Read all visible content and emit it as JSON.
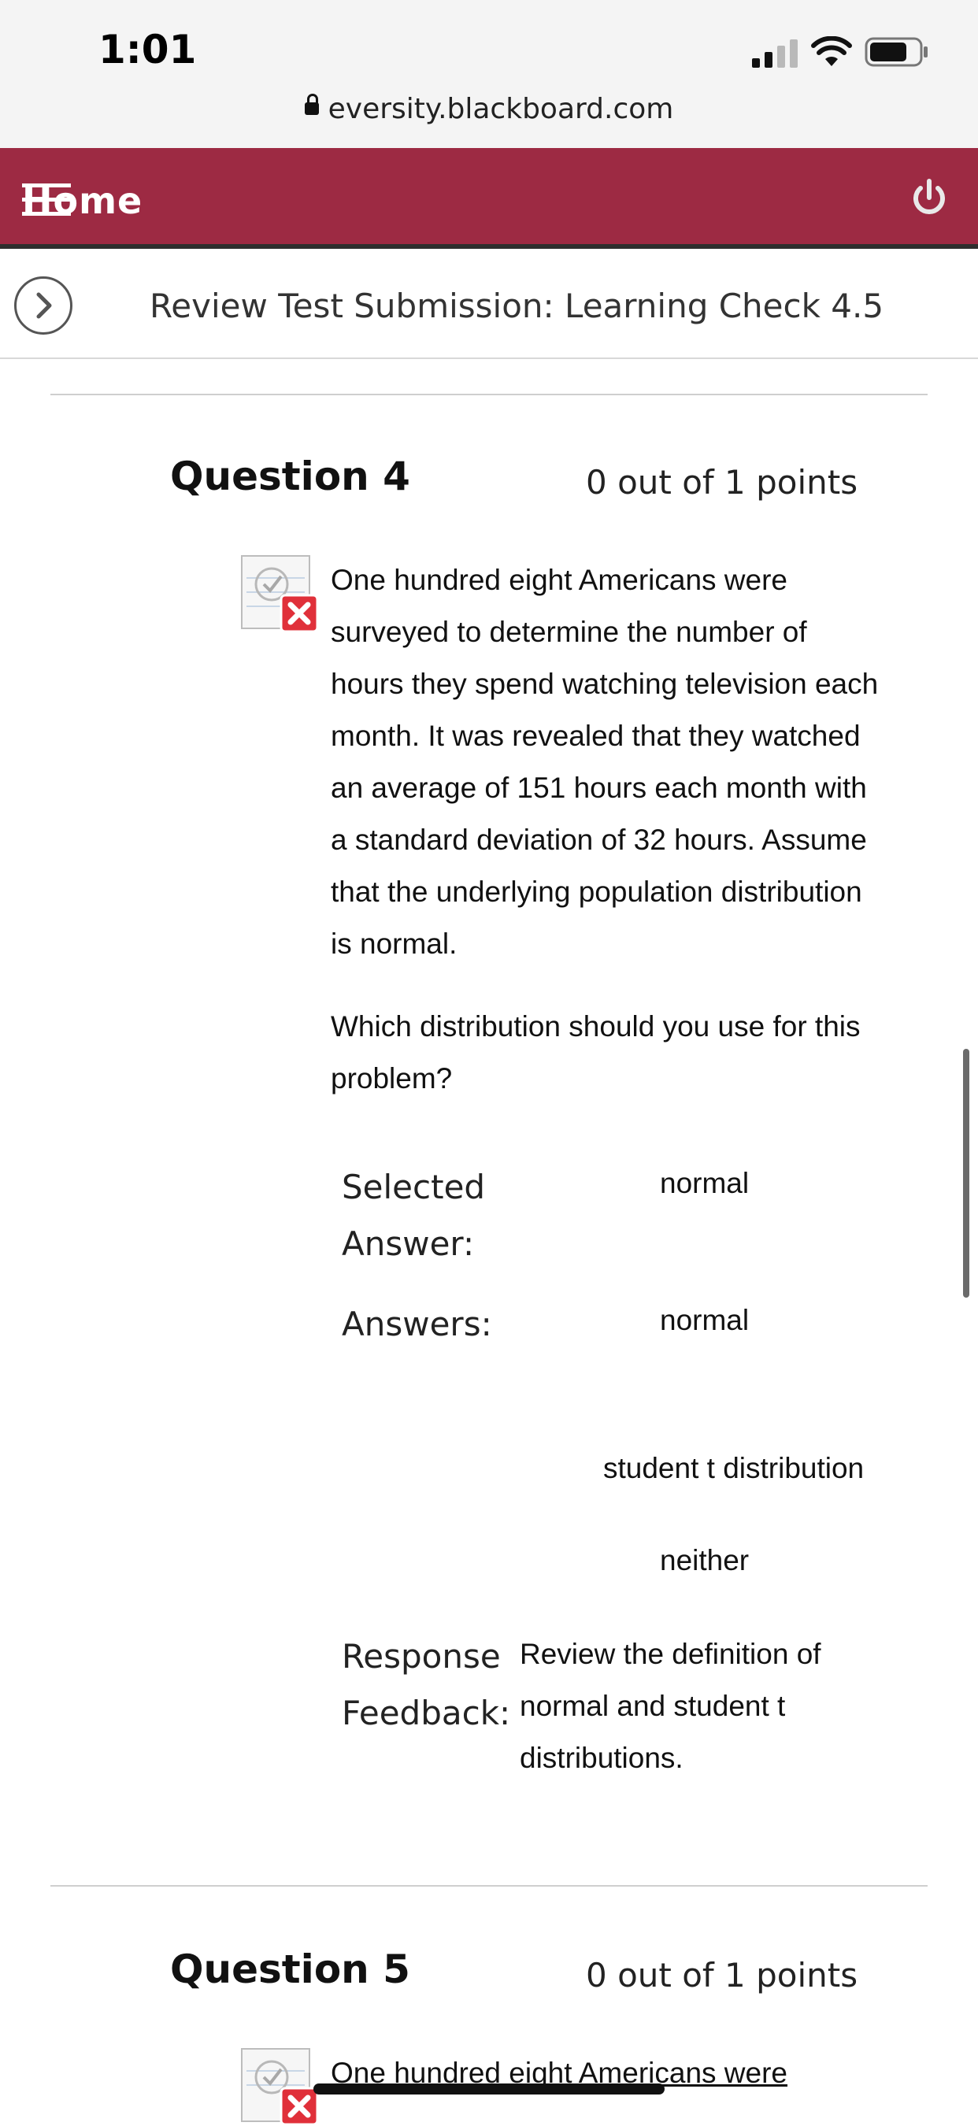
{
  "status_bar": {
    "time": "1:01",
    "url": "eversity.blackboard.com"
  },
  "nav": {
    "home_label": "Home"
  },
  "page": {
    "title": "Review Test Submission: Learning Check 4.5"
  },
  "questions": [
    {
      "title": "Question 4",
      "points": "0 out of 1 points",
      "text_lines": [
        "One hundred eight Americans were",
        "surveyed to determine the number of",
        "hours they spend watching television each",
        "month. It was revealed that they watched",
        "an average of 151 hours each month with",
        "a standard deviation of 32 hours. Assume",
        "that the underlying population distribution",
        "is normal."
      ],
      "prompt_lines": [
        "Which distribution should you use for this",
        "problem?"
      ],
      "selected_label_lines": [
        "Selected",
        "Answer:"
      ],
      "selected_answer": "normal",
      "answers_label": "Answers:",
      "answers": [
        "normal",
        "student t distribution",
        "neither"
      ],
      "feedback_label_lines": [
        "Response",
        "Feedback:"
      ],
      "feedback_lines": [
        "Review the definition of",
        "normal and student t",
        "distributions."
      ]
    },
    {
      "title": "Question 5",
      "points": "0 out of 1 points",
      "text_first_line": "One hundred eight Americans were"
    }
  ],
  "colors": {
    "nav_bg": "#9d2a43",
    "incorrect_mark": "#e0303a"
  },
  "icons": [
    "lock-icon",
    "menu-icon",
    "power-icon",
    "chevron-right-icon",
    "incorrect-answer-icon"
  ]
}
